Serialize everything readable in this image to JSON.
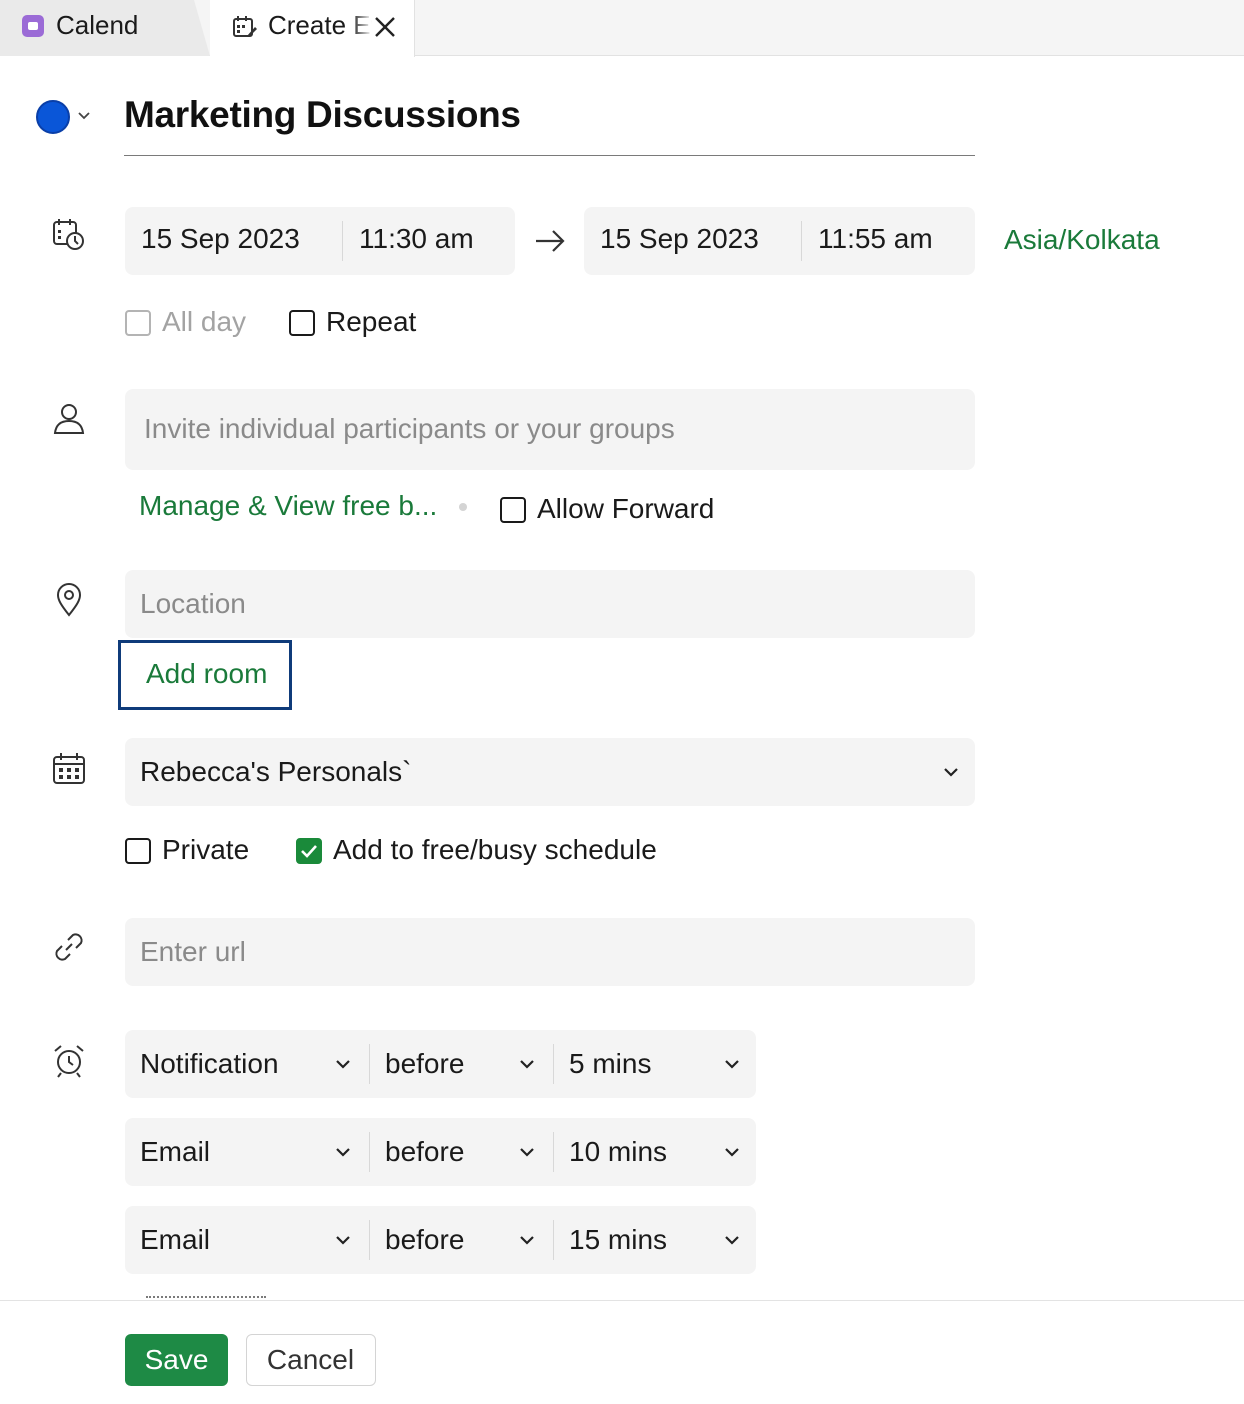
{
  "tabs": [
    {
      "label": "Calend"
    },
    {
      "label": "Create Event"
    }
  ],
  "title": "Marketing Discussions",
  "colors": {
    "event_color": "#0a56d8",
    "accent_green": "#1a7a3a",
    "save_button": "#1e8a45"
  },
  "datetime": {
    "start_date": "15 Sep 2023",
    "start_time": "11:30 am",
    "end_date": "15 Sep 2023",
    "end_time": "11:55 am",
    "timezone": "Asia/Kolkata"
  },
  "options": {
    "all_day": "All day",
    "repeat": "Repeat"
  },
  "participants": {
    "placeholder": "Invite individual participants or your groups",
    "manage_link": "Manage & View free b...",
    "allow_forward": "Allow Forward"
  },
  "location": {
    "placeholder": "Location",
    "add_room": "Add room"
  },
  "calendar": {
    "selected": "Rebecca's Personals`",
    "private": "Private",
    "add_free_busy": "Add to free/busy schedule"
  },
  "url": {
    "placeholder": "Enter url"
  },
  "reminders": [
    {
      "type": "Notification",
      "when": "before",
      "amount": "5 mins"
    },
    {
      "type": "Email",
      "when": "before",
      "amount": "10 mins"
    },
    {
      "type": "Email",
      "when": "before",
      "amount": "15 mins"
    }
  ],
  "footer": {
    "save": "Save",
    "cancel": "Cancel"
  }
}
